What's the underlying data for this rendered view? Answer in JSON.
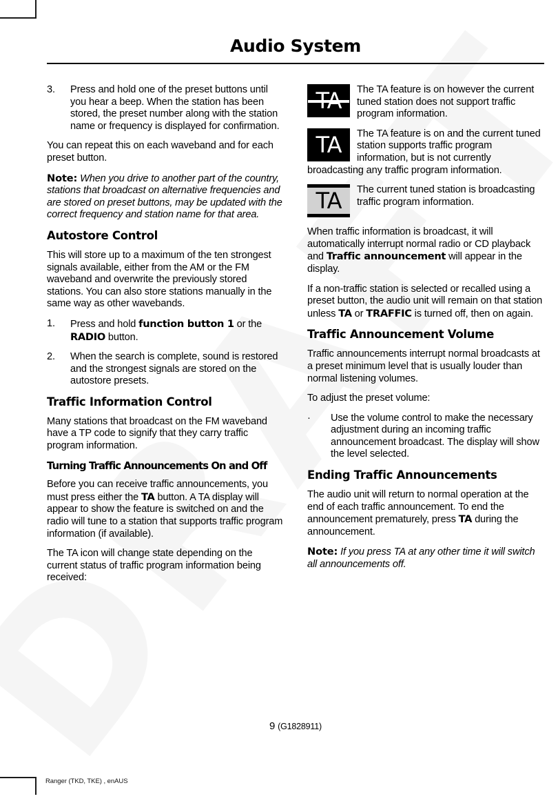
{
  "document": {
    "header_title": "Audio System",
    "page_number": "9",
    "page_code": "(G1828911)",
    "footer": "Ranger (TKD, TKE) , enAUS",
    "watermark": "DRAFT"
  },
  "left_column": {
    "step3": {
      "marker": "3.",
      "text": "Press and hold one of the preset buttons until you hear a beep. When the station has been stored, the preset number along with the station name or frequency is displayed for confirmation."
    },
    "repeat_paragraph": "You can repeat this on each waveband and for each preset button.",
    "note1": {
      "label": "Note:",
      "text": "When you drive to another part of the country, stations that broadcast on alternative frequencies and are stored on preset buttons, may be updated with the correct frequency and station name for that area."
    },
    "autostore": {
      "heading": "Autostore Control",
      "paragraph": "This will store up to a maximum of the ten strongest signals available, either from the AM or the FM waveband and overwrite the previously stored stations. You can also store stations manually in the same way as other wavebands.",
      "steps": [
        {
          "marker": "1.",
          "prefix": "Press and hold ",
          "bold1": "function button 1",
          "mid": " or the ",
          "bold2": "RADIO",
          "suffix": " button."
        },
        {
          "marker": "2.",
          "text": "When the search is complete, sound is restored and the strongest signals are stored on the autostore presets."
        }
      ]
    },
    "traffic_info": {
      "heading": "Traffic Information Control",
      "paragraph": "Many stations that broadcast on the FM waveband have a TP code to signify that they carry traffic program information."
    },
    "turning_on_off": {
      "heading": "Turning Traffic Announcements On and Off",
      "paragraph_prefix": "Before you can receive traffic announcements, you must press either the ",
      "paragraph_bold": "TA",
      "paragraph_suffix": " button. A TA display will appear to show the feature is switched on and the radio will tune to a station that supports traffic program information (if available).",
      "paragraph2": "The TA icon will change state depending on the current status of traffic program information being received:"
    }
  },
  "right_column": {
    "icon_rows": [
      {
        "icon_name": "ta-icon-on-unsupported",
        "icon_label": "TA",
        "icon_style": "black background, white TA, horizontal strike line",
        "text": "The TA feature is on however the current tuned station does not support traffic program information."
      },
      {
        "icon_name": "ta-icon-on-supported",
        "icon_label": "TA",
        "icon_style": "black background, white TA",
        "text": "The TA feature is on and the current tuned station supports traffic program information, but is not currently broadcasting any traffic program information."
      },
      {
        "icon_name": "ta-icon-broadcasting",
        "icon_label": "TA",
        "icon_style": "light grey background, black TA, black bars top and bottom",
        "text": "The current tuned station is broadcasting traffic program information."
      }
    ],
    "broadcast_paragraph": {
      "prefix": "When traffic information is broadcast, it will automatically interrupt normal radio or CD playback and ",
      "bold": "Traffic announcement",
      "suffix": " will appear in the display."
    },
    "non_traffic_paragraph": {
      "prefix": "If a non-traffic station is selected or recalled using a preset button, the audio unit will remain on that station unless ",
      "bold1": "TA",
      "mid": " or ",
      "bold2": "TRAFFIC",
      "suffix": " is turned off, then on again."
    },
    "volume": {
      "heading": "Traffic Announcement Volume",
      "paragraph": "Traffic announcements interrupt normal broadcasts at a preset minimum level that is usually louder than normal listening volumes.",
      "adjust_intro": "To adjust the preset volume:",
      "bullet_marker": "·",
      "bullet_text": "Use the volume control to make the necessary adjustment during an incoming traffic announcement broadcast. The display will show the level selected."
    },
    "ending": {
      "heading": "Ending Traffic Announcements",
      "prefix": "The audio unit will return to normal operation at the end of each traffic announcement. To end the announcement prematurely, press ",
      "bold": "TA",
      "suffix": " during the announcement."
    },
    "note2": {
      "label": "Note:",
      "text": "If you press TA at any other time it will switch all announcements off."
    }
  }
}
